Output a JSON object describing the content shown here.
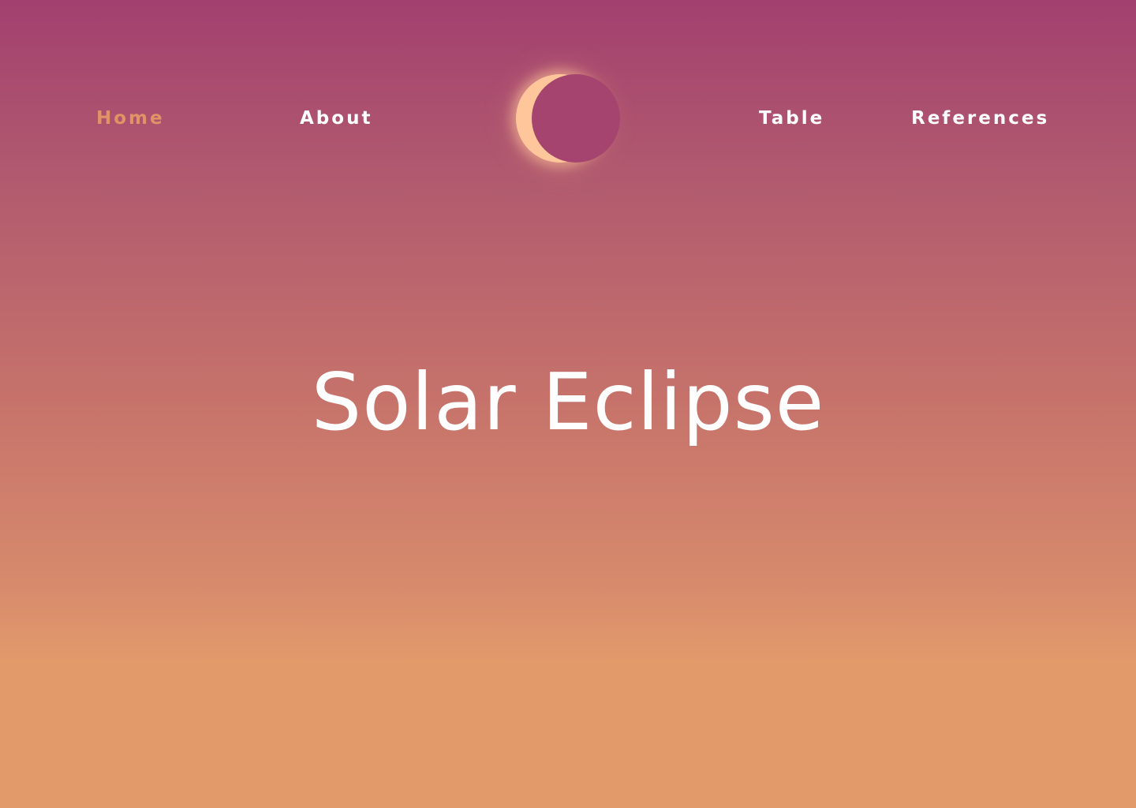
{
  "nav": {
    "items": [
      {
        "id": "home",
        "label": "Home",
        "active": true
      },
      {
        "id": "about",
        "label": "About",
        "active": false
      },
      {
        "id": "table",
        "label": "Table",
        "active": false
      },
      {
        "id": "references",
        "label": "References",
        "active": false
      }
    ],
    "logo_icon": "eclipse-icon"
  },
  "hero": {
    "title": "Solar Eclipse"
  },
  "colors": {
    "gradient_top": "#a2406f",
    "gradient_bottom": "#e29a6b",
    "active_link": "#e09465",
    "link": "#ffffff",
    "sun": "#ffc69b",
    "moon": "#a5446e"
  }
}
